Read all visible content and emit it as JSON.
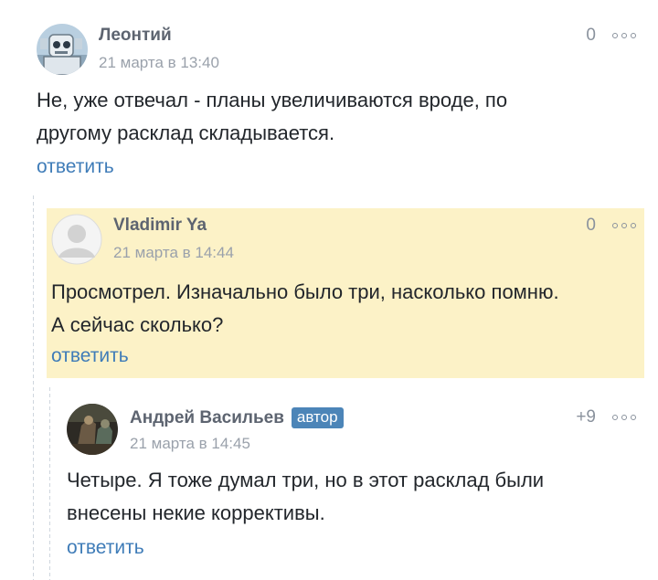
{
  "comments": [
    {
      "author": "Леонтий",
      "date": "21 марта в 13:40",
      "rating": "0",
      "text_lines": [
        "Не, уже отвечал - планы увеличиваются вроде, по",
        "другому расклад складывается."
      ],
      "reply_label": "ответить"
    },
    {
      "author": "Vladimir Ya",
      "date": "21 марта в 14:44",
      "rating": "0",
      "text_lines": [
        "Просмотрел. Изначально было три, насколько помню.",
        "А сейчас сколько?"
      ],
      "reply_label": "ответить"
    },
    {
      "author": "Андрей Васильев",
      "badge": "автор",
      "date": "21 марта в 14:45",
      "rating": "+9",
      "text_lines": [
        "Четыре. Я тоже думал три, но в этот расклад были",
        "внесены некие коррективы."
      ],
      "reply_label": "ответить"
    }
  ],
  "colors": {
    "highlight_bg": "#fcf2c7",
    "link": "#3f7cb8",
    "badge_bg": "#4c85b8"
  },
  "icons": [
    "more-options-icon"
  ]
}
